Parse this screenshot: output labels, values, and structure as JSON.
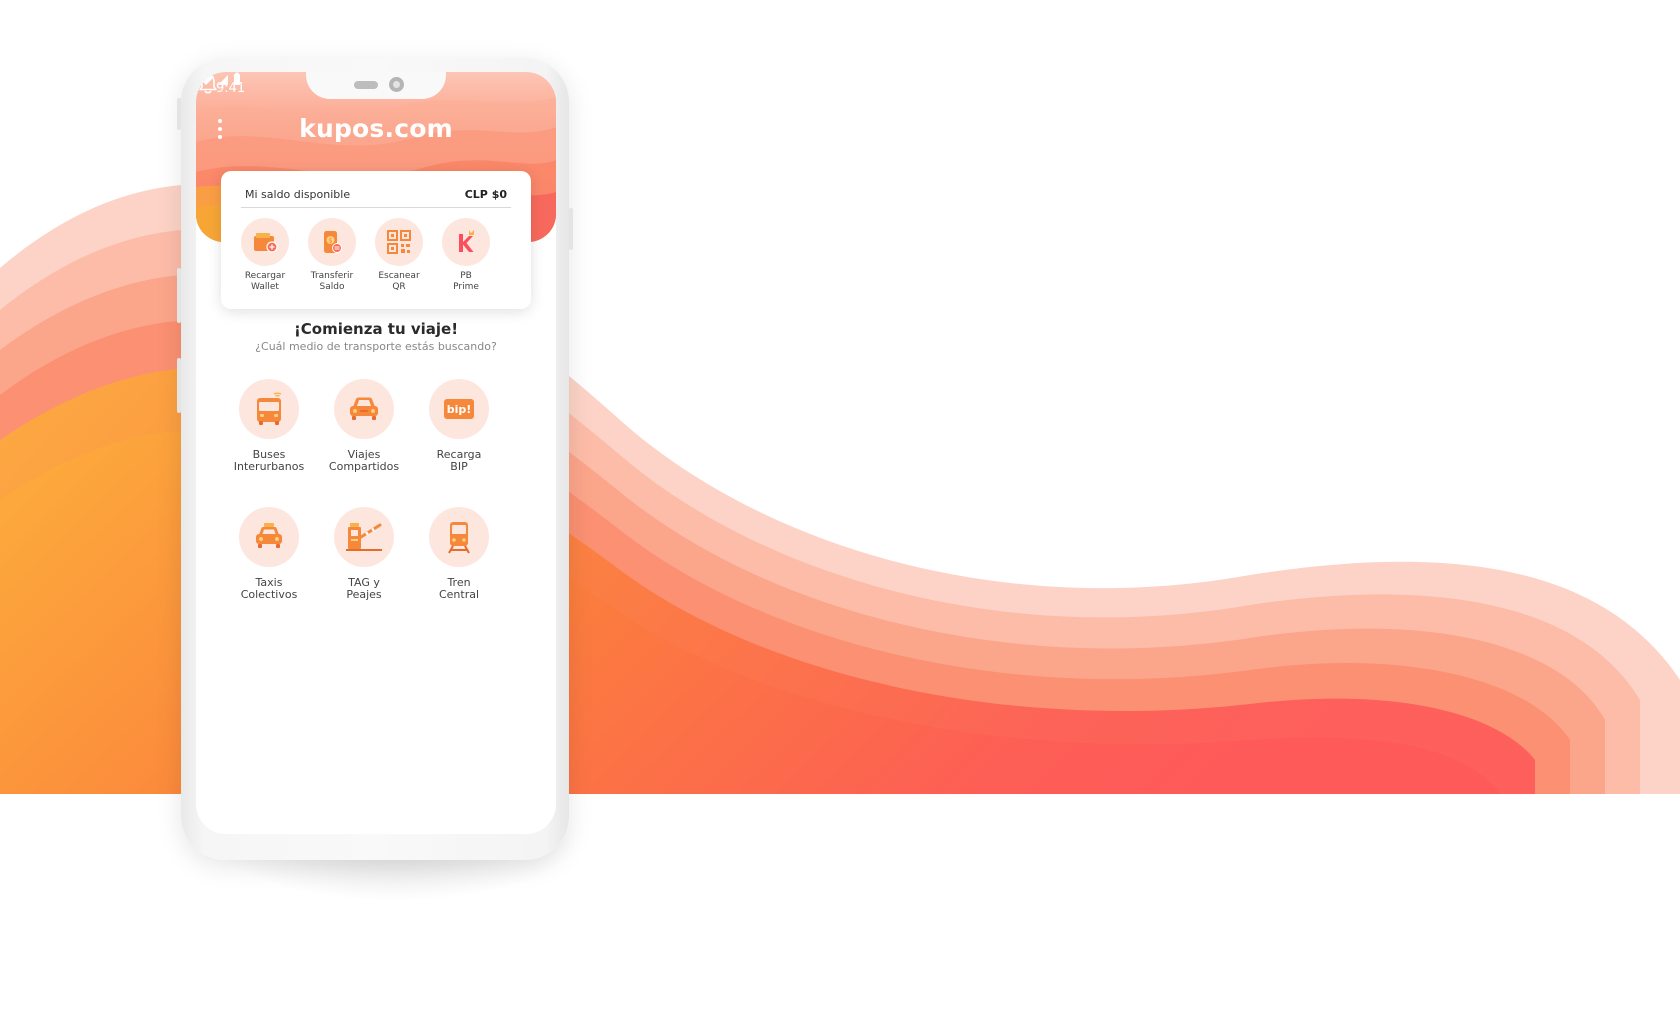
{
  "status_bar": {
    "time": "9:41"
  },
  "header": {
    "logo": "kupos.com"
  },
  "balance": {
    "label": "Mi saldo disponible",
    "value": "CLP $0",
    "actions": [
      {
        "line1": "Recargar",
        "line2": "Wallet",
        "icon": "wallet-icon"
      },
      {
        "line1": "Transferir",
        "line2": "Saldo",
        "icon": "transfer-icon"
      },
      {
        "line1": "Escanear",
        "line2": "QR",
        "icon": "qr-code-icon"
      },
      {
        "line1": "PB",
        "line2": "Prime",
        "icon": "k-crown-icon"
      }
    ]
  },
  "main": {
    "title": "¡Comienza tu viaje!",
    "subtitle": "¿Cuál medio de transporte estás buscando?",
    "services": [
      {
        "line1": "Buses",
        "line2": "Interurbanos",
        "icon": "bus-icon"
      },
      {
        "line1": "Viajes",
        "line2": "Compartidos",
        "icon": "car-icon"
      },
      {
        "line1": "Recarga",
        "line2": "BIP",
        "icon": "bip-card-icon"
      },
      {
        "line1": "Taxis",
        "line2": "Colectivos",
        "icon": "taxi-icon"
      },
      {
        "line1": "TAG y",
        "line2": "Peajes",
        "icon": "toll-gate-icon"
      },
      {
        "line1": "Tren",
        "line2": "Central",
        "icon": "train-icon"
      }
    ]
  },
  "colors": {
    "accent_orange": "#f5a046",
    "accent_coral": "#fb6c55",
    "icon_bg": "#fde6dd"
  }
}
